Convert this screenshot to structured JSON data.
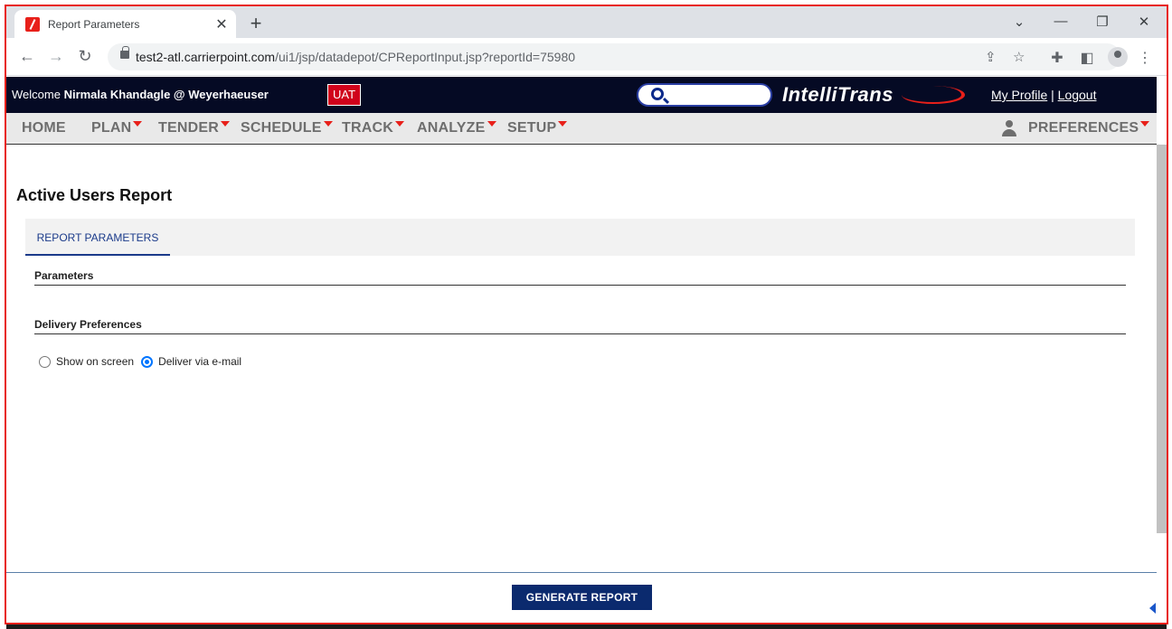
{
  "browser": {
    "tab_title": "Report Parameters",
    "tab_close": "✕",
    "new_tab": "+",
    "url_host": "test2-atl.carrierpoint.com",
    "url_path": "/ui1/jsp/datadepot/CPReportInput.jsp?reportId=75980",
    "icons": {
      "back": "arrow-left-icon",
      "forward": "arrow-right-icon",
      "reload": "reload-icon",
      "share": "share-icon",
      "bookmark": "star-icon",
      "extensions": "puzzle-icon",
      "sidepanel": "sidepanel-icon",
      "profile": "profile-icon",
      "menu": "kebab-menu-icon"
    }
  },
  "header": {
    "welcome_prefix": "Welcome ",
    "user": "Nirmala Khandagle @ Weyerhaeuser",
    "env_badge": "UAT",
    "logo": "IntelliTrans",
    "my_profile": "My Profile",
    "separator": "|",
    "logout": "Logout"
  },
  "menu": {
    "items": [
      "HOME",
      "PLAN",
      "TENDER",
      "SCHEDULE",
      "TRACK",
      "ANALYZE",
      "SETUP"
    ],
    "preferences": "PREFERENCES"
  },
  "content": {
    "title": "Active Users Report",
    "tab": "REPORT PARAMETERS",
    "parameters_label": "Parameters",
    "delivery_label": "Delivery Preferences",
    "delivery_options": [
      {
        "label": "Show on screen",
        "checked": false
      },
      {
        "label": "Deliver via e-mail",
        "checked": true
      }
    ],
    "generate_button": "GENERATE REPORT"
  },
  "colors": {
    "header_bg": "#050a24",
    "accent_red": "#e8201a",
    "button_blue": "#0b2a6e",
    "tab_blue": "#1a3a8a"
  }
}
